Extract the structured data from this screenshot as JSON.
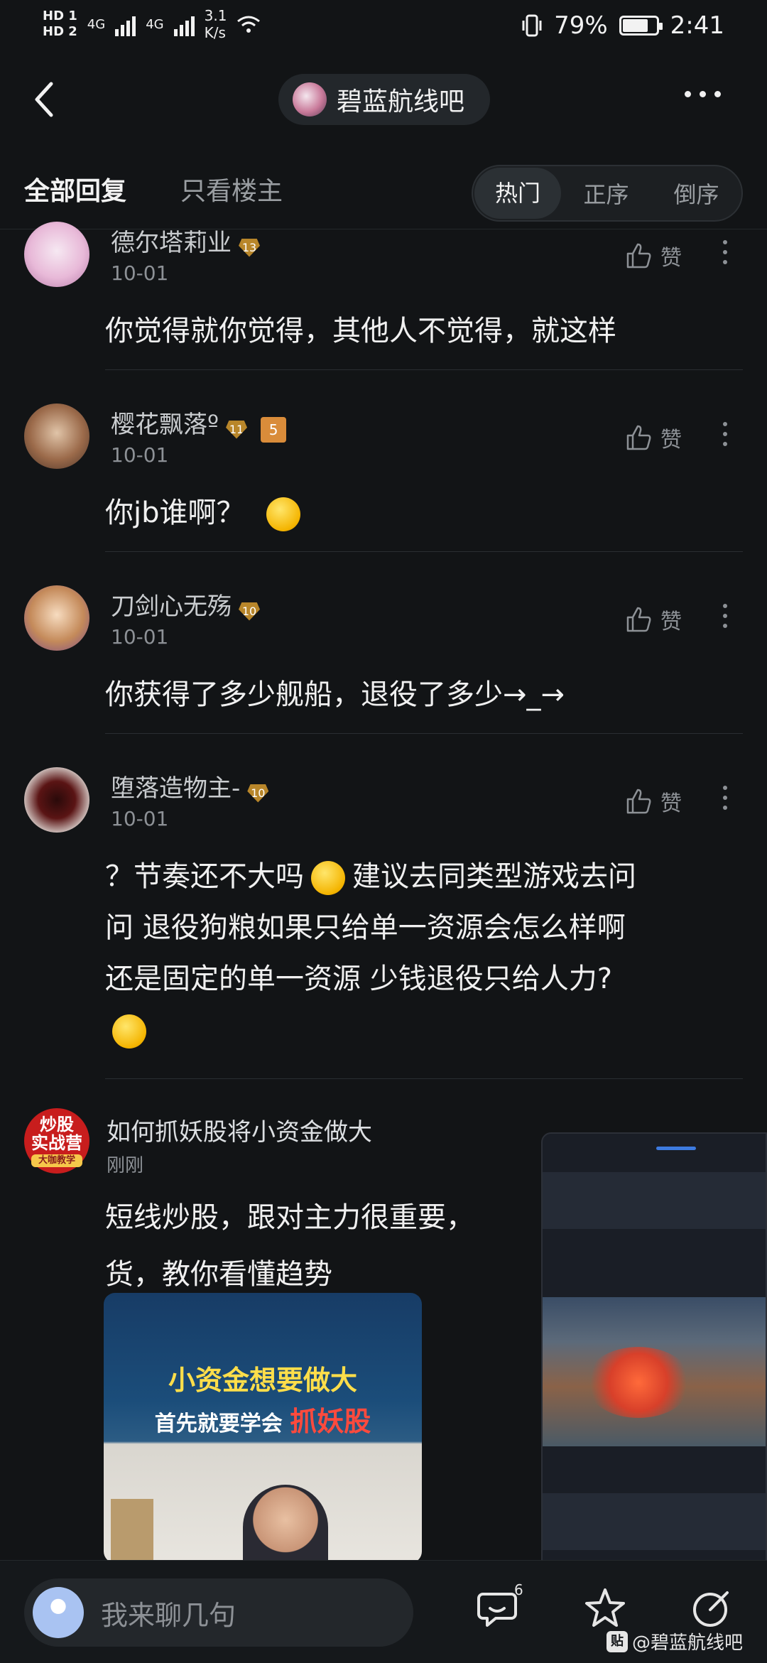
{
  "status_bar": {
    "sim1": "HD 1",
    "sim2": "HD 2",
    "net1": "4G",
    "net2": "4G",
    "speed_value": "3.1",
    "speed_unit": "K/s",
    "battery": "79%",
    "time": "2:41"
  },
  "header": {
    "forum_name": "碧蓝航线吧"
  },
  "tabs": {
    "all": "全部回复",
    "op_only": "只看楼主",
    "sort": [
      "热门",
      "正序",
      "倒序"
    ]
  },
  "comments": [
    {
      "user": "德尔塔莉业",
      "level": "13",
      "date": "10-01",
      "like_label": "赞",
      "text": "你觉得就你觉得，其他人不觉得，就这样"
    },
    {
      "user": "樱花飘落º",
      "level": "11",
      "badge": "5",
      "date": "10-01",
      "like_label": "赞",
      "text": "你jb谁啊？"
    },
    {
      "user": "刀剑心无殇",
      "level": "10",
      "date": "10-01",
      "like_label": "赞",
      "text": "你获得了多少舰船，退役了多少→_→"
    },
    {
      "user": "堕落造物主-",
      "level": "10",
      "date": "10-01",
      "like_label": "赞",
      "text_lines": [
        "？节奏还不大吗",
        "建议去同类型游戏去问",
        "问 退役狗粮如果只给单一资源会怎么样啊",
        "还是固定的单一资源 少钱退役只给人力?"
      ]
    }
  ],
  "ad": {
    "logo_line1": "炒股",
    "logo_line2": "实战营",
    "logo_line3": "大咖教学",
    "title": "如何抓妖股将小资金做大",
    "time": "刚刚",
    "text_line1": "短线炒股，跟对主力很重要，",
    "text_line2": "货，教你看懂趋势",
    "banner_line1": "小资金想要做大",
    "banner_line2_prefix": "首先就要学会",
    "banner_line2_highlight": "抓妖股"
  },
  "bottom_bar": {
    "input_placeholder": "我来聊几句",
    "comment_count": "6",
    "watermark": "@碧蓝航线吧",
    "watermark_badge": "贴"
  }
}
